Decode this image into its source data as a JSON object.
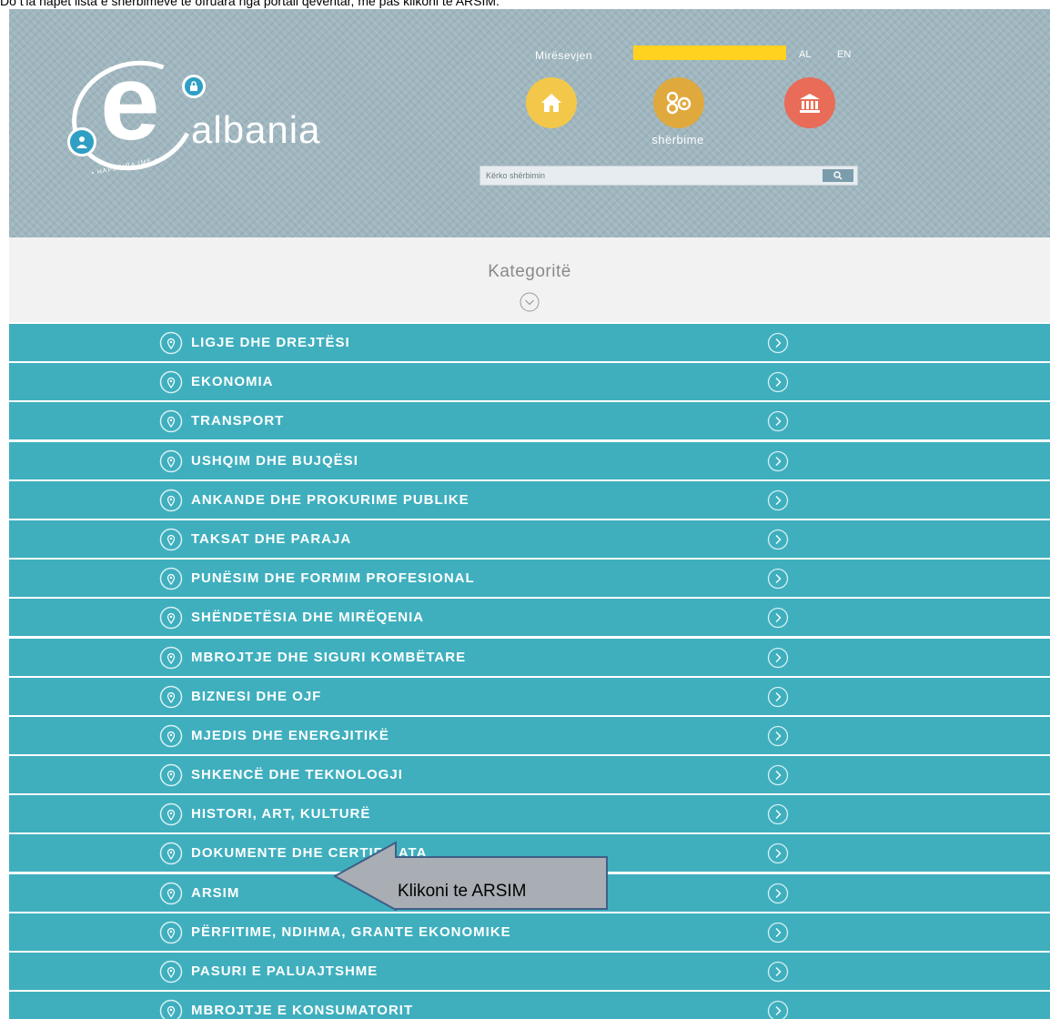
{
  "instruction": "Do t'ia hapet lista e shërbimeve të ofruara nga portali qeveritar, më pas klikoni te ARSIM.",
  "header": {
    "logo_letter": "e",
    "logo_word": "albania",
    "logo_tagline": "• HAPËSIRA IME •",
    "welcome": "Mirësevjen",
    "lang_al": "AL",
    "lang_en": "EN",
    "services_label": "shërbime",
    "search": {
      "placeholder": "Kërko shërbimin"
    },
    "icons": [
      "home-icon",
      "services-gears-icon",
      "institution-icon",
      "search-icon"
    ],
    "colors": {
      "home": "#f3c84a",
      "services": "#e0a93d",
      "institution": "#e86c57",
      "redaction": "#ffd21f"
    }
  },
  "categories": {
    "title": "Kategoritë",
    "row_color": "#3fafbe",
    "items": [
      "LIGJE DHE DREJTËSI",
      "EKONOMIA",
      "TRANSPORT",
      "USHQIM DHE BUJQËSI",
      "ANKANDE DHE PROKURIME PUBLIKE",
      "TAKSAT DHE PARAJA",
      "PUNËSIM DHE FORMIM PROFESIONAL",
      "SHËNDETËSIA DHE MIRËQENIA",
      "MBROJTJE DHE SIGURI KOMBËTARE",
      "BIZNESI DHE OJF",
      "MJEDIS DHE ENERGJITIKË",
      "SHKENCË DHE TEKNOLOGJI",
      "HISTORI, ART, KULTURË",
      "DOKUMENTE DHE CERTIFIKATA",
      "ARSIM",
      "PËRFITIME, NDIHMA, GRANTE EKONOMIKE",
      "PASURI E PALUAJTSHME",
      "MBROJTJE E KONSUMATORIT"
    ]
  },
  "callout": {
    "text": "Klikoni te ARSIM"
  }
}
